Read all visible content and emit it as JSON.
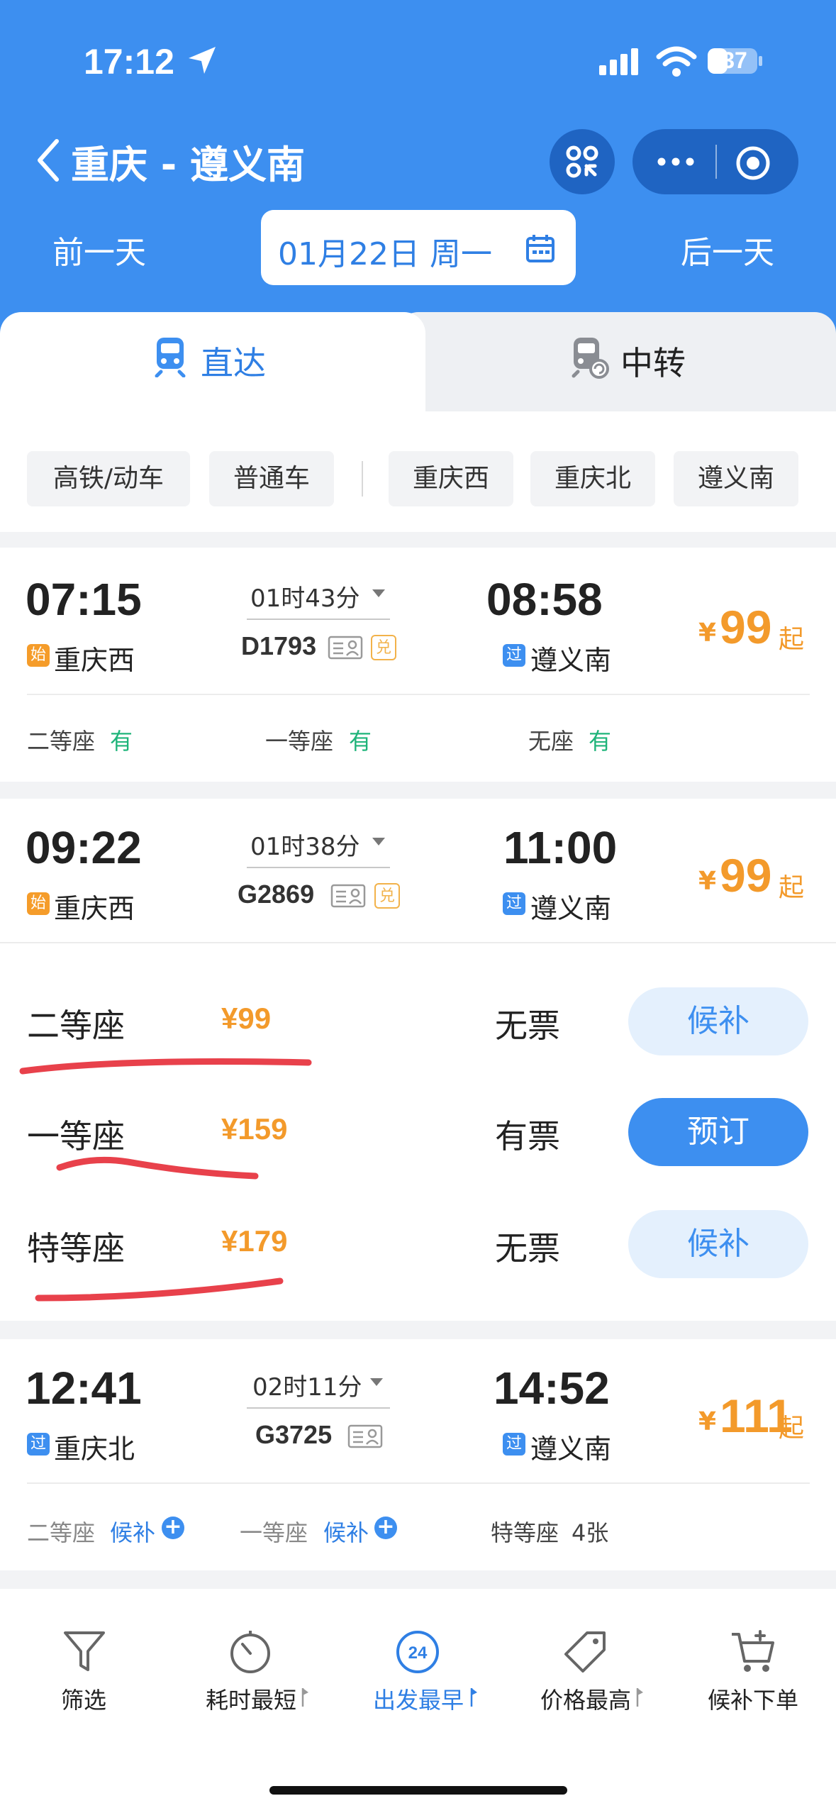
{
  "status_bar": {
    "time": "17:12",
    "battery": "37"
  },
  "header": {
    "title": "重庆 - 遵义南",
    "prev_day": "前一天",
    "next_day": "后一天",
    "date": "01月22日 周一"
  },
  "tabs": [
    {
      "label": "直达",
      "active": true
    },
    {
      "label": "中转",
      "active": false
    }
  ],
  "filters": [
    "高铁/动车",
    "普通车",
    "重庆西",
    "重庆北",
    "遵义南"
  ],
  "trains": [
    {
      "depart": "07:15",
      "arrive": "08:58",
      "duration": "01时43分",
      "number": "D1793",
      "from_tag": "始",
      "from": "重庆西",
      "to_tag": "过",
      "to": "遵义南",
      "yen": "¥",
      "price": "99",
      "qi": "起",
      "dui": "兑",
      "seats": [
        {
          "name": "二等座",
          "status": "有"
        },
        {
          "name": "一等座",
          "status": "有"
        },
        {
          "name": "无座",
          "status": "有"
        }
      ]
    },
    {
      "depart": "09:22",
      "arrive": "11:00",
      "duration": "01时38分",
      "number": "G2869",
      "from_tag": "始",
      "from": "重庆西",
      "to_tag": "过",
      "to": "遵义南",
      "yen": "¥",
      "price": "99",
      "qi": "起",
      "dui": "兑",
      "seat_rows": [
        {
          "name": "二等座",
          "price": "¥99",
          "status": "无票",
          "button": "候补",
          "button_style": "wait"
        },
        {
          "name": "一等座",
          "price": "¥159",
          "status": "有票",
          "button": "预订",
          "button_style": "book"
        },
        {
          "name": "特等座",
          "price": "¥179",
          "status": "无票",
          "button": "候补",
          "button_style": "wait"
        }
      ]
    },
    {
      "depart": "12:41",
      "arrive": "14:52",
      "duration": "02时11分",
      "number": "G3725",
      "from_tag": "过",
      "from": "重庆北",
      "to_tag": "过",
      "to": "遵义南",
      "yen": "¥",
      "price": "111",
      "qi": "起",
      "seats": [
        {
          "name": "二等座",
          "status": "候补"
        },
        {
          "name": "一等座",
          "status": "候补"
        },
        {
          "name": "特等座",
          "status": "4张"
        }
      ]
    }
  ],
  "bottom_nav": [
    {
      "label": "筛选",
      "icon": "filter-icon",
      "active": false
    },
    {
      "label": "耗时最短",
      "icon": "timer-icon",
      "active": false
    },
    {
      "label": "出发最早",
      "icon": "clock-24-icon",
      "active": true,
      "icon_text": "24"
    },
    {
      "label": "价格最高",
      "icon": "price-tag-icon",
      "active": false
    },
    {
      "label": "候补下单",
      "icon": "cart-add-icon",
      "active": false
    }
  ],
  "colors": {
    "header_blue": "#3d8ff0",
    "price_orange": "#f39a2b",
    "available_green": "#1fb47a",
    "annotation_red": "#e8414b"
  }
}
